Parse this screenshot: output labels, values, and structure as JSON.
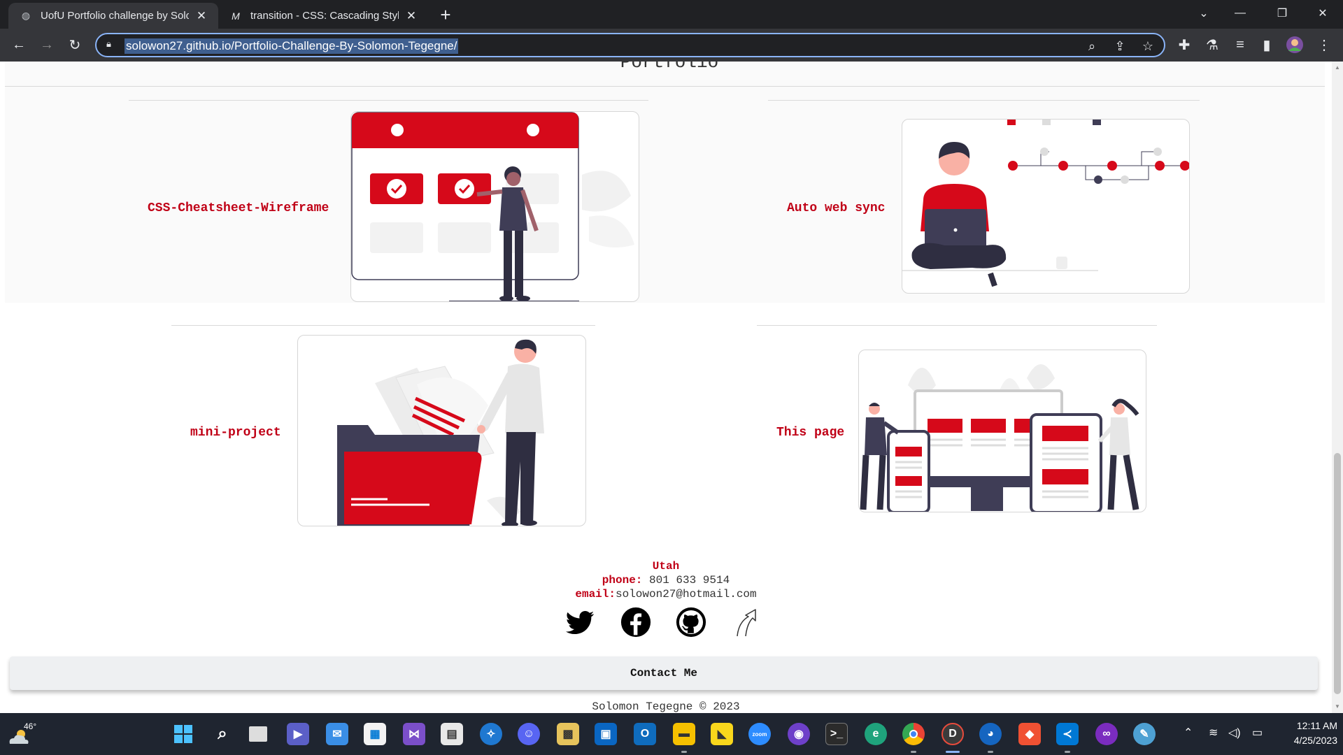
{
  "browser": {
    "tabs": [
      {
        "title": "UofU Portfolio challenge by Solomon",
        "active": true
      },
      {
        "title": "transition - CSS: Cascading Style Sheets",
        "active": false
      }
    ],
    "url": "solowon27.github.io/Portfolio-Challenge-By-Solomon-Tegegne/"
  },
  "page": {
    "section_title": "Portfolio",
    "projects": [
      {
        "label": "CSS-Cheatsheet-Wireframe"
      },
      {
        "label": "Auto web sync"
      },
      {
        "label": "mini-project"
      },
      {
        "label": "This page"
      }
    ],
    "footer": {
      "location": "Utah",
      "phone_label": "phone:",
      "phone": " 801 633 9514",
      "email_label": "email:",
      "email": "solowon27@hotmail.com",
      "socials": [
        "twitter-icon",
        "facebook-icon",
        "github-icon",
        "arrow-up-icon"
      ],
      "contact_label": "Contact Me",
      "copyright": "Solomon Tegegne © 2023"
    },
    "colors": {
      "accent": "#c00016",
      "dark": "#3f3d56"
    }
  },
  "taskbar": {
    "weather": "46°",
    "time": "12:11 AM",
    "date": "4/25/2023"
  }
}
